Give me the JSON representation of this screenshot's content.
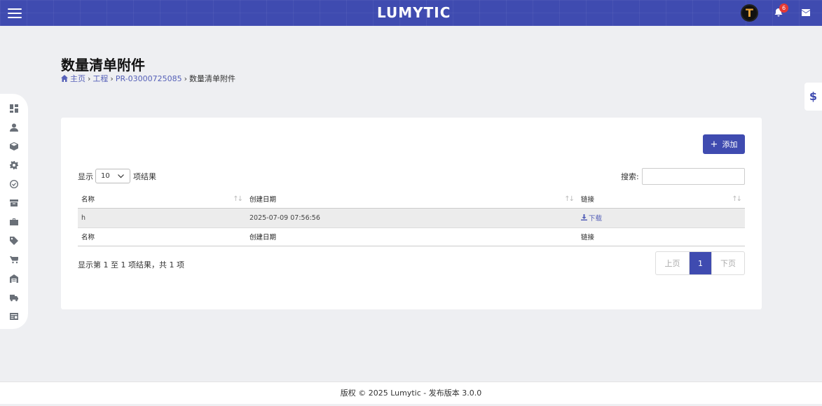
{
  "header": {
    "logo": "LUMYTIC",
    "avatar_letter": "T",
    "notification_count": "6",
    "colors": {
      "bar": "#3f4bb0",
      "badge": "#e53935"
    }
  },
  "sidebar": {
    "icons": [
      "dashboard-icon",
      "user-icon",
      "box-icon",
      "settings-gear-icon",
      "check-circle-icon",
      "archive-icon",
      "briefcase-icon",
      "tag-icon",
      "cart-icon",
      "warehouse-icon",
      "truck-icon",
      "invoice-icon"
    ]
  },
  "right_tab": {
    "label": "$"
  },
  "page": {
    "title": "数量清单附件",
    "breadcrumb": {
      "home": "主页",
      "project": "工程",
      "pr": "PR-03000725085",
      "current": "数量清单附件"
    }
  },
  "toolbar": {
    "add_label": "添加"
  },
  "length_menu": {
    "show": "显示",
    "value": "10",
    "suffix": "项结果"
  },
  "search": {
    "label": "搜索:",
    "value": ""
  },
  "table": {
    "columns": [
      "名称",
      "创建日期",
      "链接"
    ],
    "rows": [
      {
        "name": "h",
        "date": "2025-07-09 07:56:56",
        "link": "下载"
      }
    ]
  },
  "info": "显示第 1 至 1 项结果，共 1 项",
  "pagination": {
    "prev": "上页",
    "current": "1",
    "next": "下页"
  },
  "footer": "版权 © 2025 Lumytic - 发布版本 3.0.0"
}
